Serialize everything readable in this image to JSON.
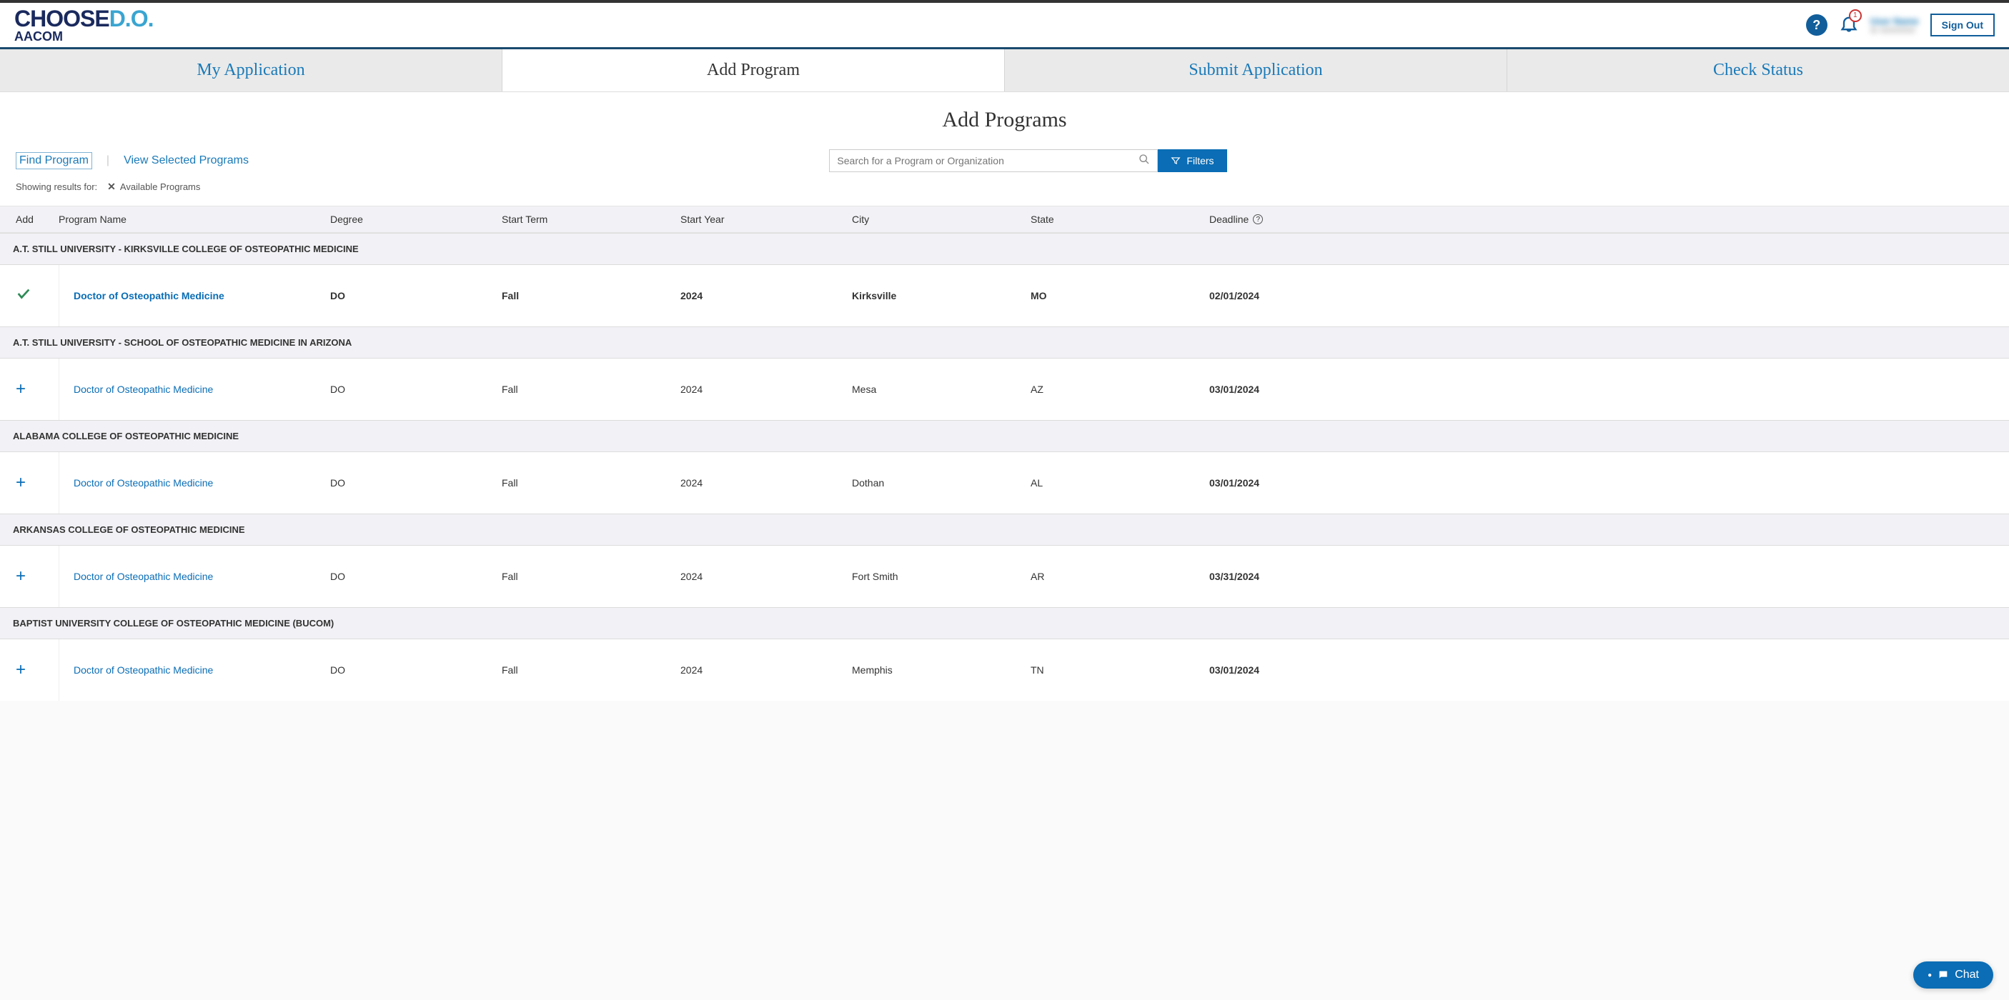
{
  "branding": {
    "logo_prefix": "CHOOSE",
    "logo_suffix": "D.O.",
    "sub": "AACOM"
  },
  "header": {
    "notification_count": "1",
    "user_name": "User Name",
    "user_id": "ID 00000000",
    "signout": "Sign Out"
  },
  "tabs": {
    "my_application": "My Application",
    "add_program": "Add Program",
    "submit_application": "Submit Application",
    "check_status": "Check Status"
  },
  "page_title": "Add Programs",
  "subtabs": {
    "find": "Find Program",
    "view": "View Selected Programs"
  },
  "search": {
    "placeholder": "Search for a Program or Organization",
    "filters_label": "Filters"
  },
  "results_hint": {
    "label": "Showing results for:",
    "chip": "Available Programs"
  },
  "columns": {
    "add": "Add",
    "name": "Program Name",
    "degree": "Degree",
    "term": "Start Term",
    "year": "Start Year",
    "city": "City",
    "state": "State",
    "deadline": "Deadline"
  },
  "groups": [
    {
      "title": "A.T. STILL UNIVERSITY - KIRKSVILLE COLLEGE OF OSTEOPATHIC MEDICINE",
      "rows": [
        {
          "selected": true,
          "name": "Doctor of Osteopathic Medicine",
          "degree": "DO",
          "term": "Fall",
          "year": "2024",
          "city": "Kirksville",
          "state": "MO",
          "deadline": "02/01/2024"
        }
      ]
    },
    {
      "title": "A.T. STILL UNIVERSITY - SCHOOL OF OSTEOPATHIC MEDICINE IN ARIZONA",
      "rows": [
        {
          "selected": false,
          "name": "Doctor of Osteopathic Medicine",
          "degree": "DO",
          "term": "Fall",
          "year": "2024",
          "city": "Mesa",
          "state": "AZ",
          "deadline": "03/01/2024"
        }
      ]
    },
    {
      "title": "ALABAMA COLLEGE OF OSTEOPATHIC MEDICINE",
      "rows": [
        {
          "selected": false,
          "name": "Doctor of Osteopathic Medicine",
          "degree": "DO",
          "term": "Fall",
          "year": "2024",
          "city": "Dothan",
          "state": "AL",
          "deadline": "03/01/2024"
        }
      ]
    },
    {
      "title": "ARKANSAS COLLEGE OF OSTEOPATHIC MEDICINE",
      "rows": [
        {
          "selected": false,
          "name": "Doctor of Osteopathic Medicine",
          "degree": "DO",
          "term": "Fall",
          "year": "2024",
          "city": "Fort Smith",
          "state": "AR",
          "deadline": "03/31/2024"
        }
      ]
    },
    {
      "title": "BAPTIST UNIVERSITY COLLEGE OF OSTEOPATHIC MEDICINE (BUCOM)",
      "rows": [
        {
          "selected": false,
          "name": "Doctor of Osteopathic Medicine",
          "degree": "DO",
          "term": "Fall",
          "year": "2024",
          "city": "Memphis",
          "state": "TN",
          "deadline": "03/01/2024"
        }
      ]
    }
  ],
  "chat_label": "Chat"
}
